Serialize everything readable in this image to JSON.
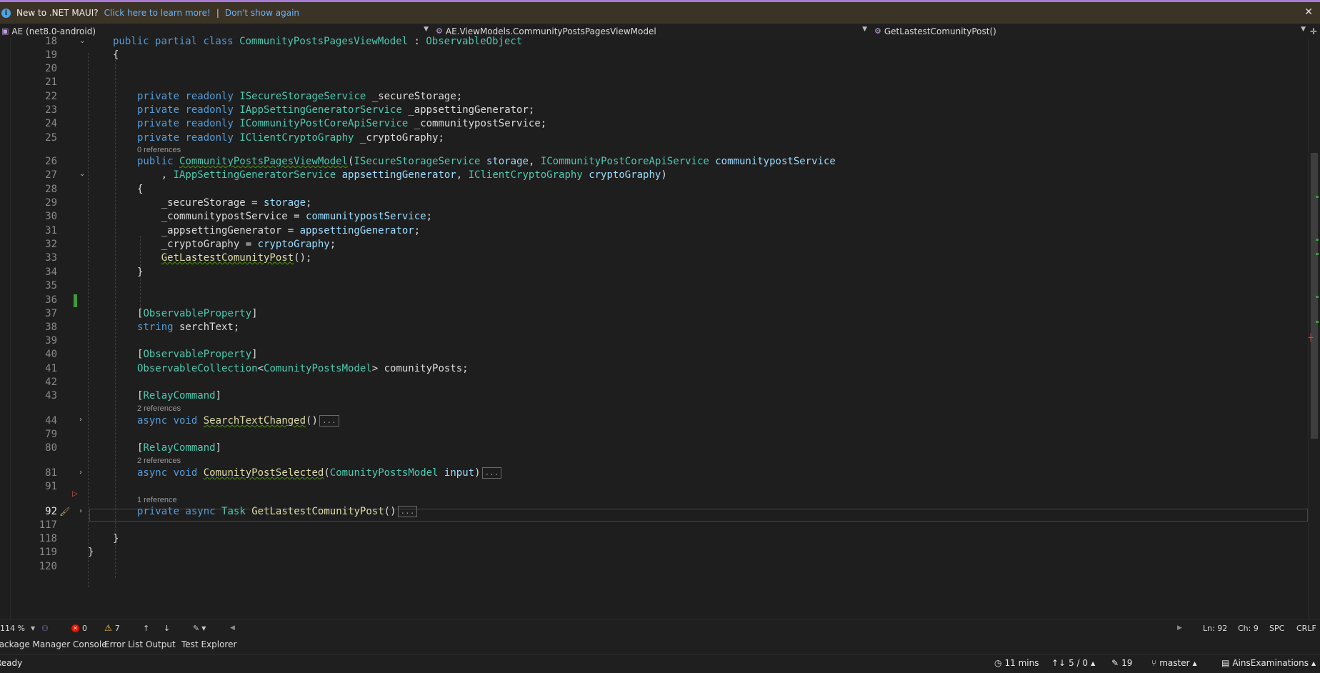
{
  "infobar": {
    "message": "New to .NET MAUI?",
    "learn_link": "Click here to learn more!",
    "separator": "|",
    "dismiss_link": "Don't show again",
    "close_glyph": "✕"
  },
  "navbar": {
    "project": "AE (net8.0-android)",
    "type": "AE.ViewModels.CommunityPostsPagesViewModel",
    "member": "GetLastestComunityPost()"
  },
  "editor": {
    "line_numbers": [
      "18",
      "19",
      "20",
      "21",
      "22",
      "23",
      "24",
      "25",
      "26",
      "27",
      "28",
      "29",
      "30",
      "31",
      "32",
      "33",
      "34",
      "35",
      "36",
      "37",
      "38",
      "39",
      "40",
      "41",
      "42",
      "43",
      "44",
      "79",
      "80",
      "81",
      "91",
      "92",
      "117",
      "118",
      "119",
      "120"
    ],
    "codelens": {
      "ctor_refs": "0 references",
      "search_refs": "2 references",
      "selected_refs": "2 references",
      "getlatest_refs": "1 reference"
    },
    "collapsed_marker": "...",
    "current_line": "92"
  },
  "status": {
    "zoom": "114 %",
    "errors": "0",
    "warnings": "7",
    "ln": "Ln: 92",
    "ch": "Ch: 9",
    "spc": "SPC",
    "crlf": "CRLF"
  },
  "tool_windows": {
    "package_manager": "Package Manager Console",
    "error_list": "Error List",
    "output": "Output",
    "test_explorer": "Test Explorer"
  },
  "bottombar": {
    "ready": "Ready",
    "time": "11 mins",
    "commits": "5 / 0",
    "changes": "19",
    "branch": "master",
    "repo": "AinsExaminations"
  }
}
